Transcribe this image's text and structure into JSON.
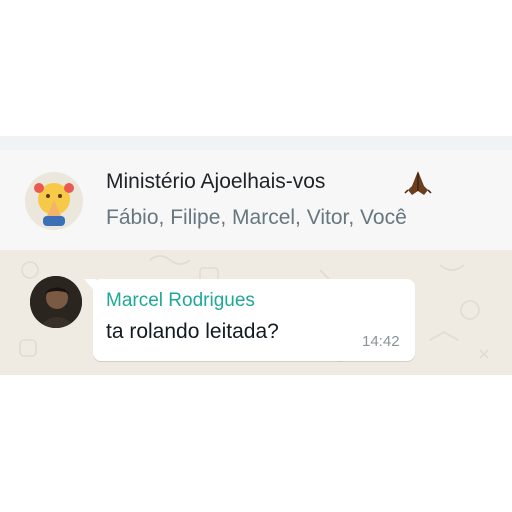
{
  "chat_header": {
    "group_name": "Ministério Ajoelhais-vos",
    "title_icon": "folded-hands-icon",
    "members": "Fábio, Filipe, Marcel, Vitor, Você",
    "avatar_icon": "praying-emoji-avatar"
  },
  "messages": [
    {
      "sender": "Marcel Rodrigues",
      "text": "ta rolando leitada?",
      "time": "14:42",
      "avatar_icon": "user-avatar"
    }
  ],
  "colors": {
    "header_bg": "#f7f7f7",
    "chat_bg": "#efeae2",
    "sender_name": "#1fa898",
    "bubble_bg": "#ffffff"
  }
}
